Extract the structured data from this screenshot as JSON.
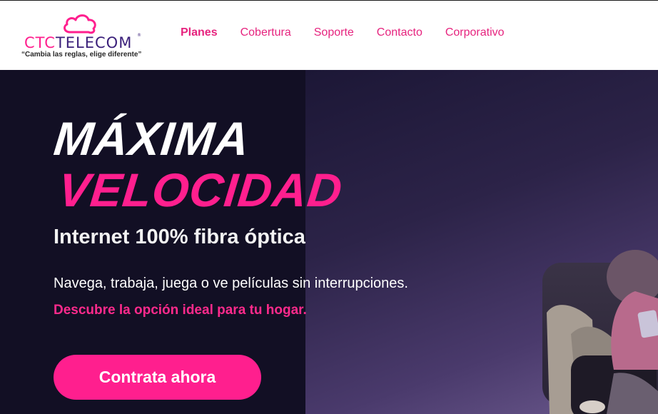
{
  "brand": {
    "name_pink": "CTC",
    "name_purple": "TELECOM",
    "registered": "®",
    "tagline": "“Cambia las reglas, elige diferente”",
    "colors": {
      "pink": "#ff1f8e",
      "purple": "#3a1f7a",
      "dark": "#120f24"
    }
  },
  "nav": {
    "items": [
      {
        "label": "Planes"
      },
      {
        "label": "Cobertura"
      },
      {
        "label": "Soporte"
      },
      {
        "label": "Contacto"
      },
      {
        "label": "Corporativo"
      }
    ]
  },
  "hero": {
    "title_line1": "MÁXIMA",
    "title_line2": "VELOCIDAD",
    "subtitle": "Internet 100% fibra óptica",
    "description": "Navega, trabaja, juega o ve películas sin interrupciones.",
    "highlight": "Descubre la opción ideal para tu hogar.",
    "cta_label": "Contrata ahora"
  }
}
